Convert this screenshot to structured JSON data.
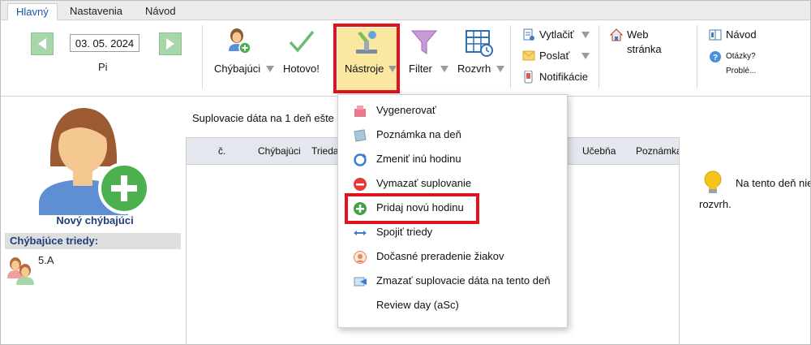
{
  "tabs": [
    {
      "label": "Hlavný",
      "active": true
    },
    {
      "label": "Nastavenia",
      "active": false
    },
    {
      "label": "Návod",
      "active": false
    }
  ],
  "date": {
    "value": "03. 05. 2024",
    "day": "Pi"
  },
  "ribbon": {
    "absent_label": "Chýbajúci",
    "done_label": "Hotovo!",
    "tools_label": "Nástroje",
    "filter_label": "Filter",
    "timetable_label": "Rozvrh",
    "print_label": "Vytlačiť",
    "send_label": "Poslať",
    "notifications_label": "Notifikácie",
    "web_label": "Web stránka",
    "guide_label": "Návod",
    "questions_label": "Otázky? Problé..."
  },
  "left_panel": {
    "new_absent_label": "Nový chýbajúci",
    "classes_header": "Chýbajúce triedy:",
    "classes": [
      "5.A"
    ]
  },
  "main": {
    "info_text": "Suplovacie dáta na 1 deň ešte",
    "columns": [
      "č.",
      "Chýbajúci",
      "Trieda",
      "Učebňa",
      "Poznámka"
    ]
  },
  "note": {
    "line1": "Na tento deň nie",
    "line2": "rozvrh."
  },
  "menu": {
    "items": [
      {
        "label": "Vygenerovať",
        "icon": "generate-icon"
      },
      {
        "label": "Poznámka na deň",
        "icon": "note-icon"
      },
      {
        "label": "Zmeniť inú hodinu",
        "icon": "refresh-icon"
      },
      {
        "label": "Vymazať suplovanie",
        "icon": "delete-icon"
      },
      {
        "label": "Pridaj novú hodinu",
        "icon": "add-icon"
      },
      {
        "label": "Spojiť triedy",
        "icon": "merge-icon"
      },
      {
        "label": "Dočasné preradenie žiakov",
        "icon": "students-icon"
      },
      {
        "label": "Zmazať suplovacie dáta na tento deň",
        "icon": "erase-icon"
      },
      {
        "label": "Review day (aSc)",
        "icon": ""
      }
    ]
  },
  "colors": {
    "highlight": "#e0131d",
    "active_tools_bg": "#fbe8a0",
    "nav_green": "#a6d6a9",
    "text_blue": "#1f3f7a"
  }
}
